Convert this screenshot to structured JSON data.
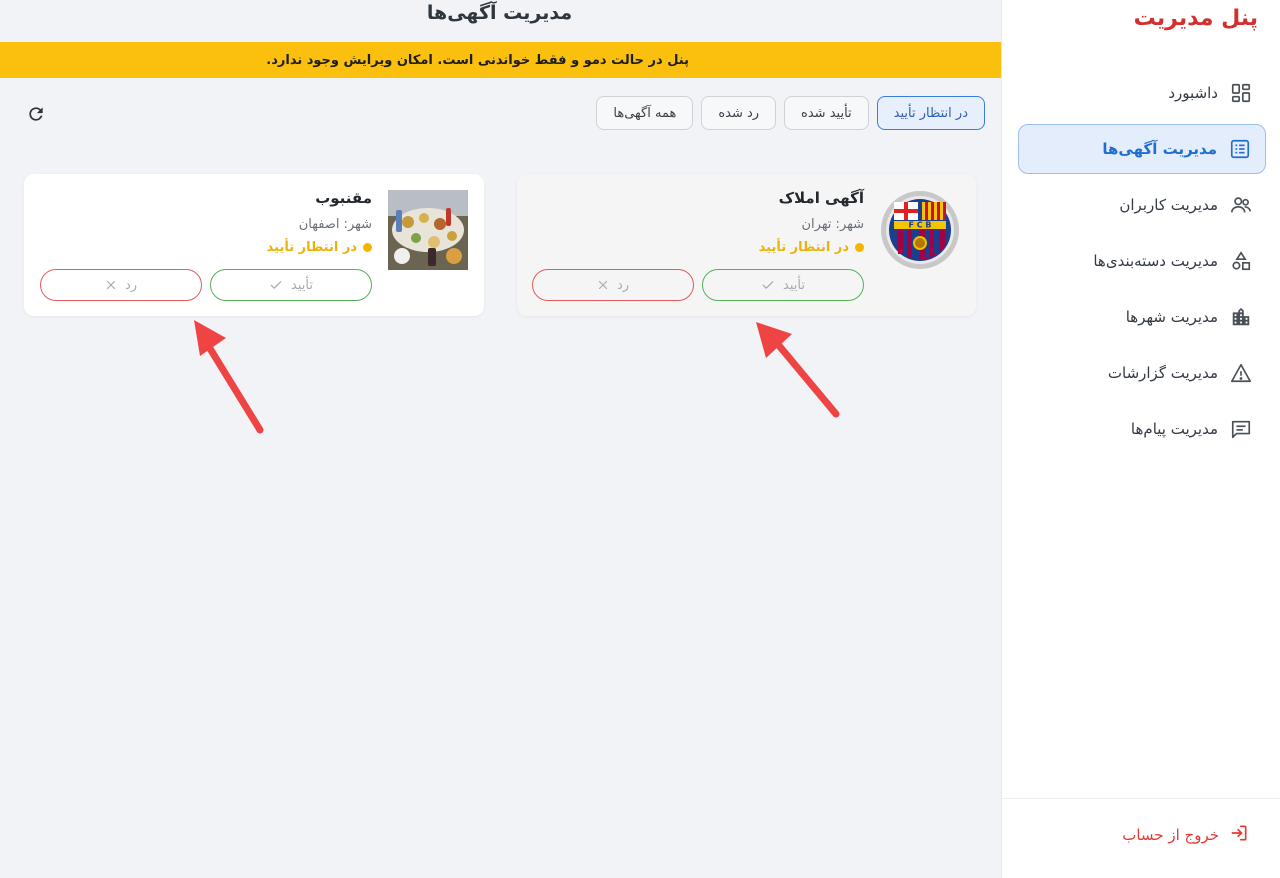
{
  "sidebar": {
    "brand": "پنل مدیریت",
    "items": [
      {
        "label": "داشبورد",
        "icon": "dashboard-icon"
      },
      {
        "label": "مدیریت آگهی‌ها",
        "icon": "list-icon"
      },
      {
        "label": "مدیریت کاربران",
        "icon": "users-icon"
      },
      {
        "label": "مدیریت دسته‌بندی‌ها",
        "icon": "categories-icon"
      },
      {
        "label": "مدیریت شهرها",
        "icon": "city-icon"
      },
      {
        "label": "مدیریت گزارشات",
        "icon": "warning-icon"
      },
      {
        "label": "مدیریت پیام‌ها",
        "icon": "message-icon"
      }
    ],
    "active_index": 1,
    "logout": "خروج از حساب"
  },
  "header": {
    "title": "مدیریت آگهی‌ها",
    "banner": "پنل در حالت دمو و فقط خواندنی است. امکان ویرایش وجود ندارد."
  },
  "filters": {
    "pending": "در انتظار تأیید",
    "approved": "تأیید شده",
    "rejected": "رد شده",
    "all": "همه آگهی‌ها"
  },
  "ads": [
    {
      "title": "آگهی املاک",
      "city": "شهر: تهران",
      "status": "در انتظار تأیید",
      "approve": "تأیید",
      "reject": "رد",
      "thumb_text": "FCB"
    },
    {
      "title": "مقنبوب",
      "city": "شهر: اصفهان",
      "status": "در انتظار تأیید",
      "approve": "تأیید",
      "reject": "رد"
    }
  ],
  "colors": {
    "accent": "#1f6fd0",
    "brand": "#d32f2f",
    "banner": "#fbbf0e",
    "pending": "#eab308",
    "approve": "#55b05a",
    "reject": "#e35b5b",
    "annotation_arrow": "#ef4444"
  }
}
